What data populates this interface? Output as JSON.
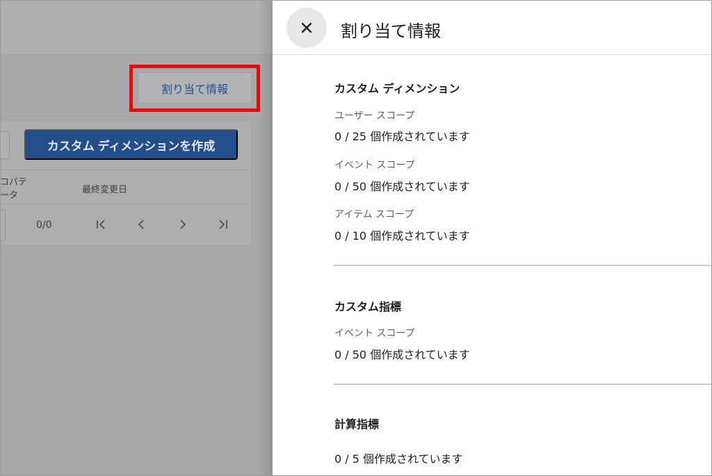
{
  "background": {
    "assign_button_label": "割り当て情報",
    "create_button_label": "カスタム ディメンションを作成",
    "table_headers": {
      "property_line1": "コパテ",
      "property_line2": "ータ",
      "last_modified": "最終変更日"
    },
    "pager_count": "0/0",
    "pager_icons": [
      "first-page-icon",
      "prev-page-icon",
      "next-page-icon",
      "last-page-icon"
    ]
  },
  "panel": {
    "title": "割り当て情報",
    "close_icon": "close-icon",
    "sections": {
      "custom_dimensions": {
        "title": "カスタム ディメンション",
        "user_scope": {
          "label": "ユーザー スコープ",
          "value": "0 / 25 個作成されています"
        },
        "event_scope": {
          "label": "イベント スコープ",
          "value": "0 / 50 個作成されています"
        },
        "item_scope": {
          "label": "アイテム スコープ",
          "value": "0 / 10 個作成されています"
        }
      },
      "custom_metrics": {
        "title": "カスタム指標",
        "event_scope": {
          "label": "イベント スコープ",
          "value": "0 / 50 個作成されています"
        }
      },
      "calculated_metrics": {
        "title": "計算指標",
        "value": "0 / 5 個作成されています"
      }
    }
  },
  "colors": {
    "highlight": "#ea0a0a",
    "primary_button": "#224e8c",
    "overlay_background": "#a7a8a9"
  }
}
